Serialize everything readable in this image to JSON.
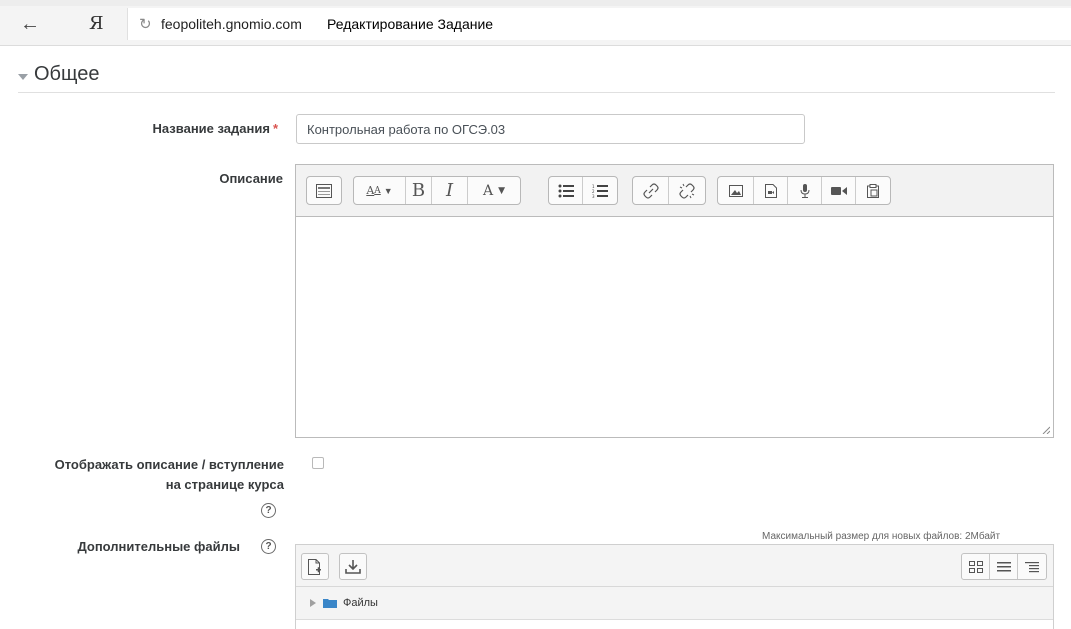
{
  "browser": {
    "back_glyph": "←",
    "logo": "Я",
    "reload_glyph": "↻",
    "domain": "feopoliteh.gnomio.com",
    "page_title": "Редактирование Задание"
  },
  "section": {
    "title": "Общее"
  },
  "form": {
    "name_label": "Название задания",
    "required_mark": "*",
    "name_value": "Контрольная работа по ОГСЭ.03",
    "description_label": "Описание",
    "show_description_label_line1": "Отображать описание / вступление",
    "show_description_label_line2": "на странице курса",
    "show_description_checked": false,
    "additional_files_label": "Дополнительные файлы",
    "help_glyph": "?",
    "max_size_text": "Максимальный размер для новых файлов: 2Мбайт"
  },
  "editor_toolbar": {
    "groups": [
      [
        "toggle-toolbar-icon"
      ],
      [
        "font-size-icon",
        "bold-icon",
        "italic-icon",
        "font-color-icon"
      ],
      [
        "unordered-list-icon",
        "ordered-list-icon"
      ],
      [
        "link-icon",
        "unlink-icon"
      ],
      [
        "image-icon",
        "media-icon",
        "record-audio-icon",
        "record-video-icon",
        "paste-icon"
      ]
    ],
    "bold_glyph": "B",
    "italic_glyph": "I",
    "font_color_glyph": "A"
  },
  "filemanager": {
    "path_label": "Файлы",
    "views": [
      "icons-view-icon",
      "list-view-icon",
      "tree-view-icon"
    ]
  }
}
